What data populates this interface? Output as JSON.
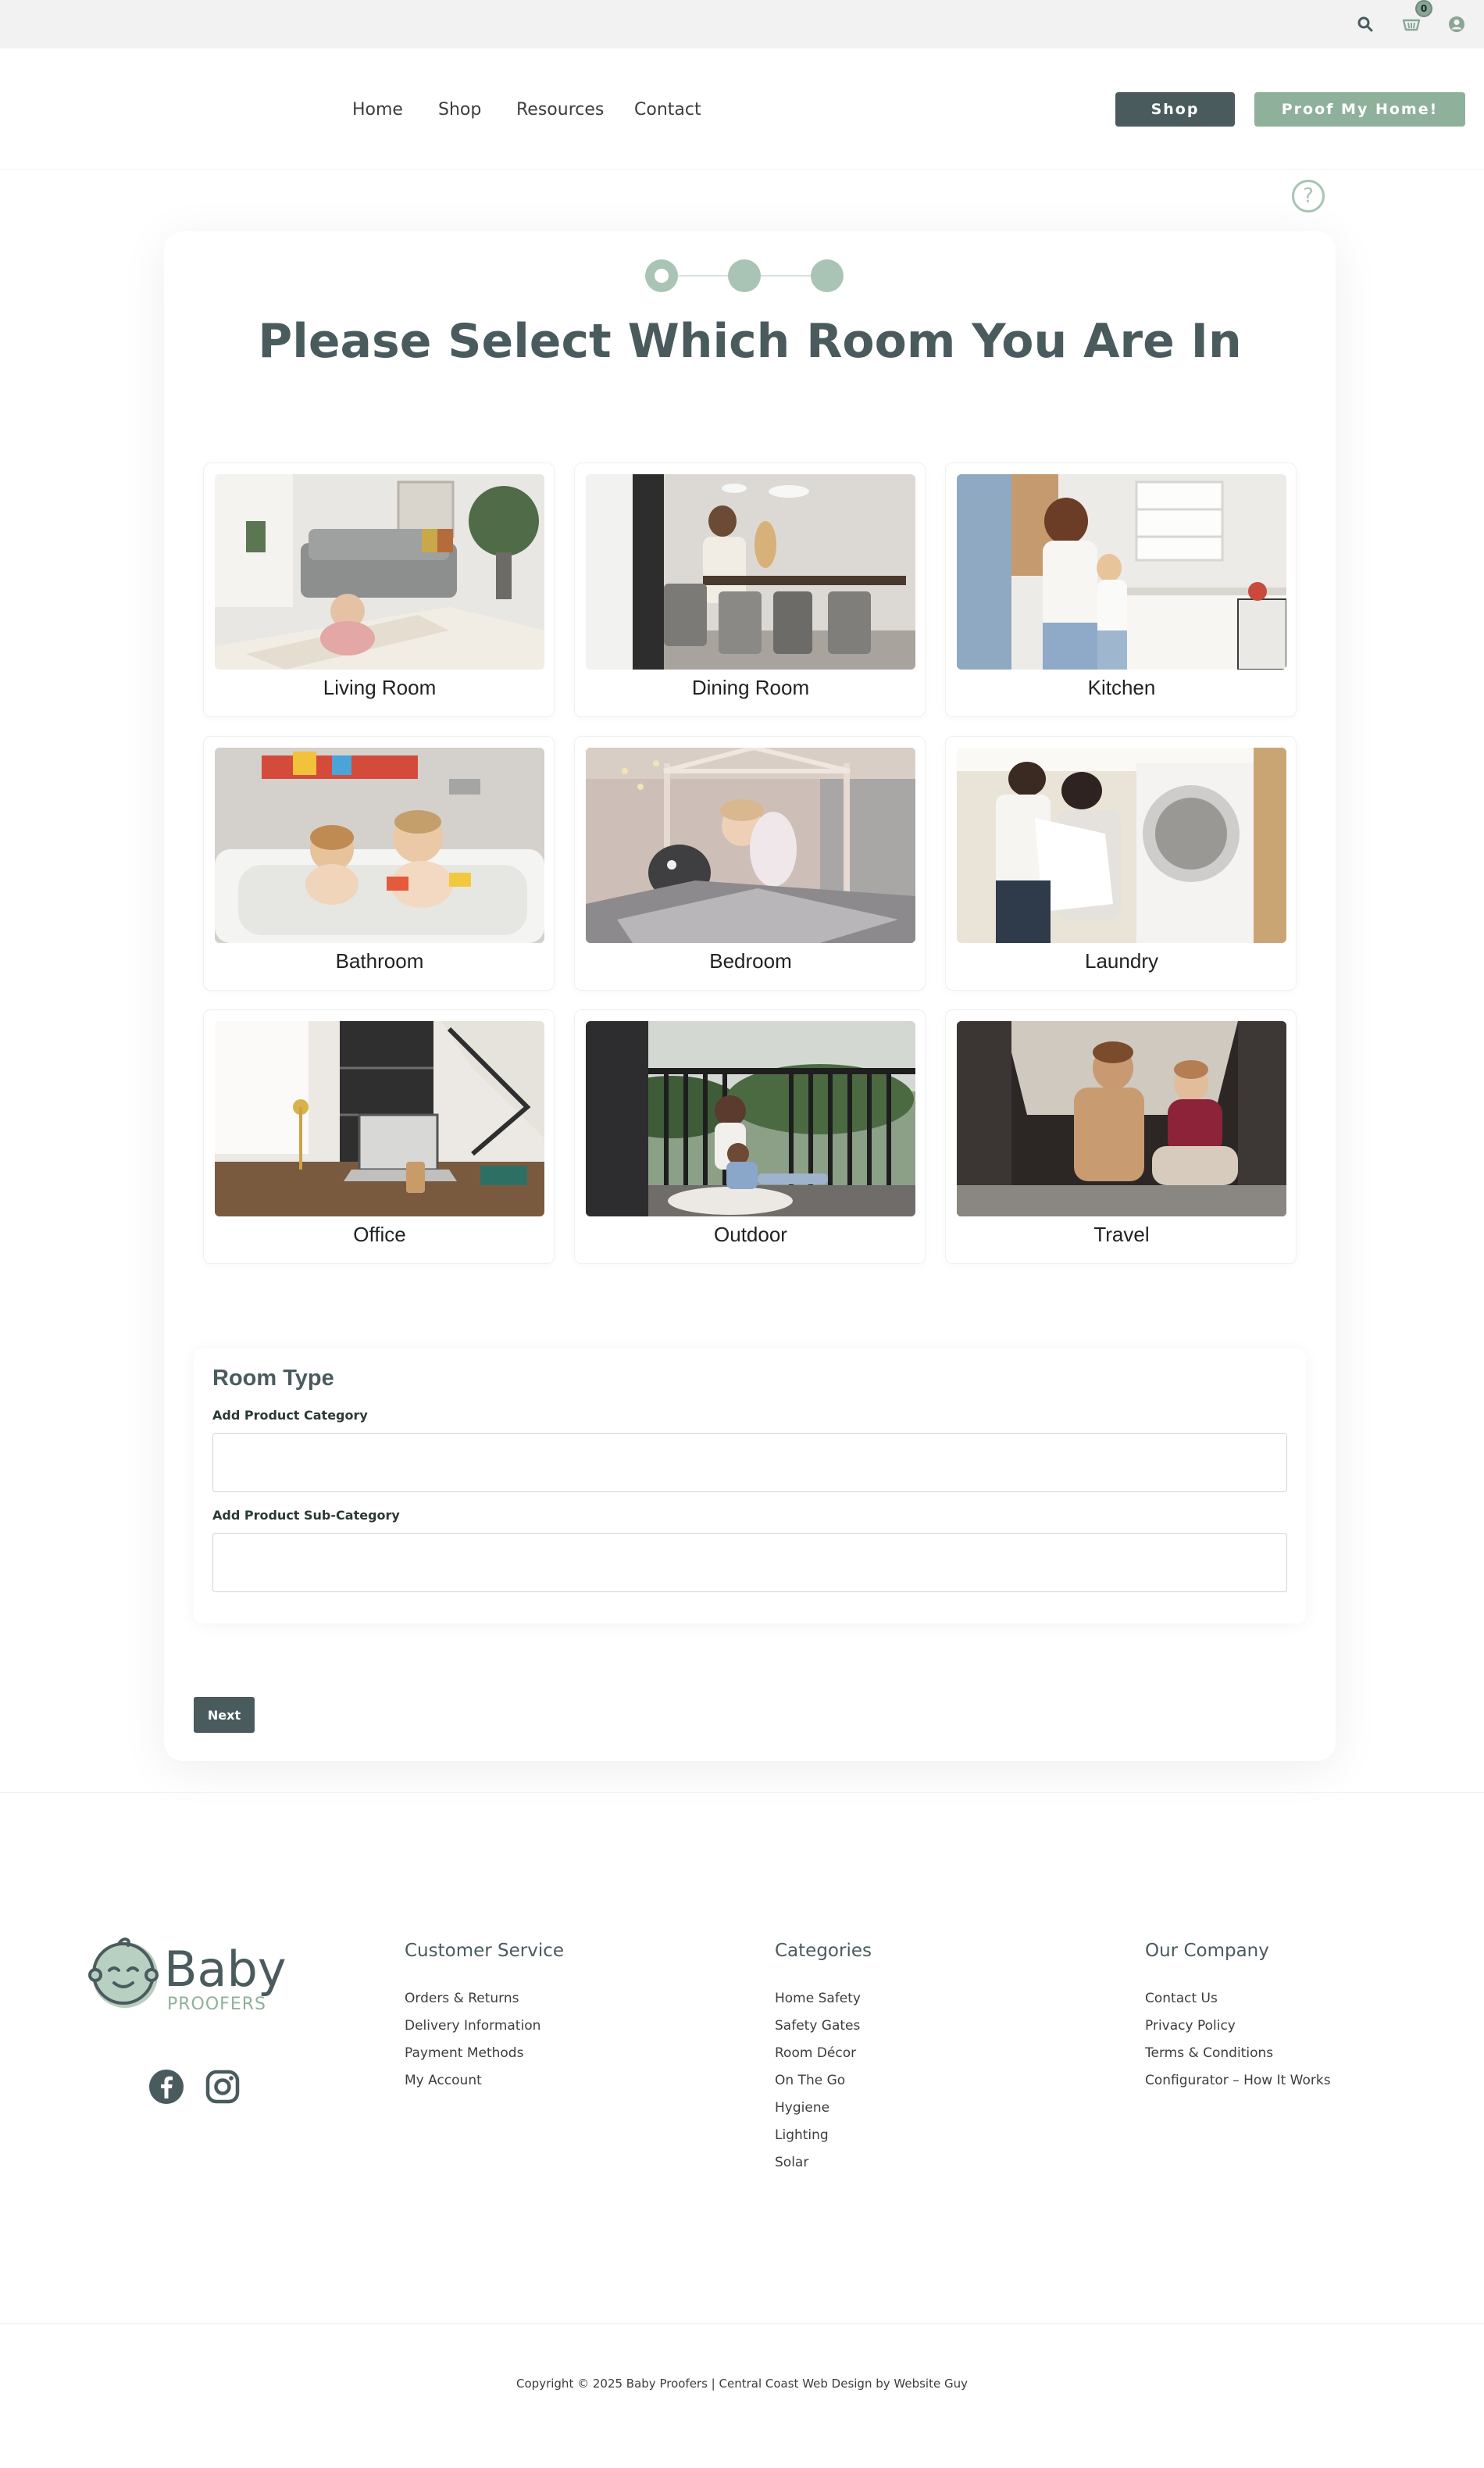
{
  "topbar": {
    "icons": [
      "search-icon",
      "cart-icon",
      "user-icon"
    ],
    "cart_count": "0"
  },
  "nav": {
    "items": [
      "Home",
      "Shop",
      "Resources",
      "Contact"
    ]
  },
  "header": {
    "shop_button": "Shop",
    "proof_button": "Proof My Home!"
  },
  "help": {
    "icon": "?"
  },
  "steps": {
    "current": 1,
    "total": 3
  },
  "page": {
    "title": "Please Select Which Room You Are In"
  },
  "rooms": [
    {
      "label": "Living Room"
    },
    {
      "label": "Dining Room"
    },
    {
      "label": "Kitchen"
    },
    {
      "label": "Bathroom"
    },
    {
      "label": "Bedroom"
    },
    {
      "label": "Laundry"
    },
    {
      "label": "Office"
    },
    {
      "label": "Outdoor"
    },
    {
      "label": "Travel"
    }
  ],
  "form": {
    "title": "Room Type",
    "category_label": "Add Product Category",
    "category_value": "",
    "subcategory_label": "Add Product Sub-Category",
    "subcategory_value": "",
    "next_button": "Next"
  },
  "footer": {
    "logo_main": "Baby",
    "logo_sub": "PROOFERS",
    "social": [
      "facebook-icon",
      "instagram-icon"
    ],
    "columns": [
      {
        "title": "Customer Service",
        "links": [
          "Orders & Returns",
          "Delivery Information",
          "Payment Methods",
          "My Account"
        ]
      },
      {
        "title": "Categories",
        "links": [
          "Home Safety",
          "Safety Gates",
          "Room Décor",
          "On The Go",
          "Hygiene",
          "Lighting",
          "Solar"
        ]
      },
      {
        "title": "Our Company",
        "links": [
          "Contact Us",
          "Privacy Policy",
          "Terms & Conditions",
          "Configurator – How It Works"
        ]
      }
    ],
    "copyright": "Copyright © 2025 Baby Proofers | Central Coast Web Design by Website Guy"
  },
  "colors": {
    "accent": "#8fb19c",
    "dark": "#4a5b5e",
    "light_accent": "#a9c4b4"
  }
}
